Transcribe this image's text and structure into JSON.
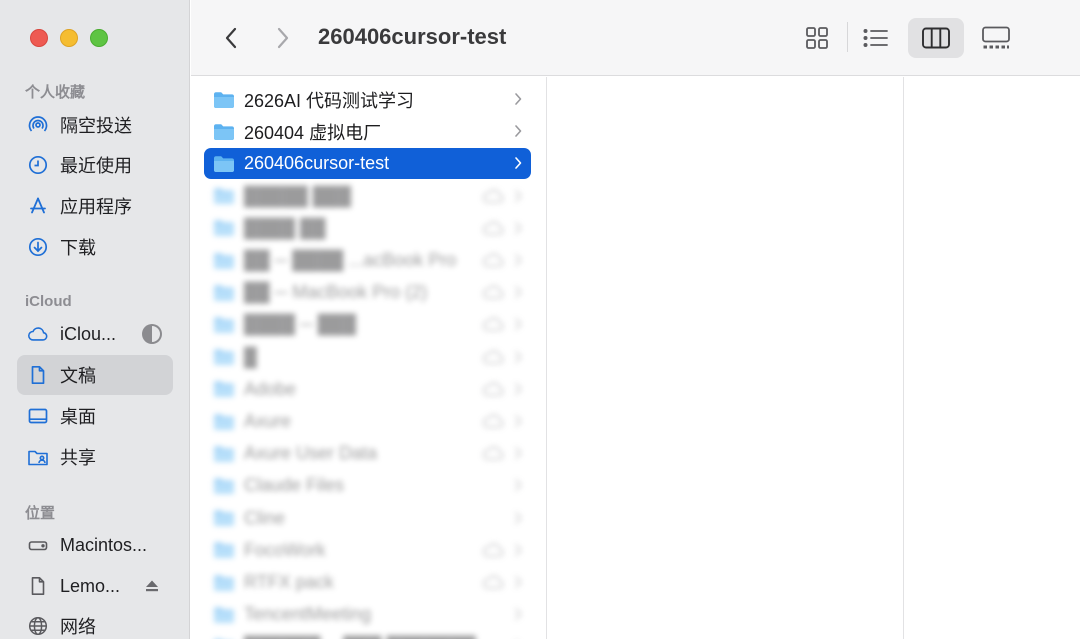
{
  "window": {
    "title": "260406cursor-test",
    "traffic_lights": {
      "close": "#ee5a52",
      "minimize": "#f5bd31",
      "zoom": "#5ec443"
    }
  },
  "sidebar": {
    "sections": [
      {
        "title": "个人收藏",
        "items": [
          {
            "label": "隔空投送",
            "icon": "airdrop-icon"
          },
          {
            "label": "最近使用",
            "icon": "clock-icon"
          },
          {
            "label": "应用程序",
            "icon": "applications-icon"
          },
          {
            "label": "下载",
            "icon": "download-icon"
          }
        ]
      },
      {
        "title": "iCloud",
        "items": [
          {
            "label": "iClou...",
            "icon": "cloud-icon",
            "extra": "storage-pie-icon"
          },
          {
            "label": "文稿",
            "icon": "document-icon",
            "selected": true
          },
          {
            "label": "桌面",
            "icon": "desktop-icon"
          },
          {
            "label": "共享",
            "icon": "shared-folder-icon"
          }
        ]
      },
      {
        "title": "位置",
        "items": [
          {
            "label": "Macintos...",
            "icon": "hard-drive-icon"
          },
          {
            "label": "Lemo...",
            "icon": "file-icon",
            "extra": "eject-icon"
          },
          {
            "label": "网络",
            "icon": "network-globe-icon"
          }
        ]
      }
    ]
  },
  "toolbar": {
    "back": "chevron-left-icon",
    "forward": "chevron-right-icon",
    "views": [
      {
        "name": "icon-view",
        "icon": "grid-icon",
        "active": false
      },
      {
        "name": "list-view",
        "icon": "list-icon",
        "active": false
      },
      {
        "name": "column-view",
        "icon": "columns-icon",
        "active": true
      },
      {
        "name": "gallery-view",
        "icon": "gallery-icon",
        "active": false
      }
    ]
  },
  "column1": {
    "items": [
      {
        "name": "2626AI 代码测试学习",
        "type": "folder",
        "blurred": false,
        "selected": false
      },
      {
        "name": "260404 虚拟电厂",
        "type": "folder",
        "blurred": false,
        "selected": false
      },
      {
        "name": "260406cursor-test",
        "type": "folder",
        "blurred": false,
        "selected": true
      },
      {
        "name": "",
        "type": "folder",
        "blurred": true,
        "cloud": true
      },
      {
        "name": "",
        "type": "folder",
        "blurred": true,
        "cloud": true
      },
      {
        "name": "",
        "type": "folder",
        "blurred": true,
        "cloud": true
      },
      {
        "name": "",
        "type": "folder",
        "blurred": true,
        "cloud": true
      },
      {
        "name": "",
        "type": "folder",
        "blurred": true,
        "cloud": true
      },
      {
        "name": "",
        "type": "folder",
        "blurred": true,
        "cloud": true
      },
      {
        "name": "",
        "type": "folder",
        "blurred": true,
        "cloud": true
      },
      {
        "name": "",
        "type": "folder",
        "blurred": true,
        "cloud": true
      },
      {
        "name": "",
        "type": "folder",
        "blurred": true,
        "cloud": true
      },
      {
        "name": "",
        "type": "folder",
        "blurred": true,
        "cloud": false
      },
      {
        "name": "",
        "type": "folder",
        "blurred": true,
        "cloud": false
      },
      {
        "name": "",
        "type": "folder",
        "blurred": true,
        "cloud": true
      },
      {
        "name": "",
        "type": "folder",
        "blurred": true,
        "cloud": true
      },
      {
        "name": "",
        "type": "folder",
        "blurred": true,
        "cloud": false
      },
      {
        "name": "",
        "type": "folder",
        "blurred": true,
        "cloud": false
      }
    ]
  },
  "colors": {
    "selection": "#1060d8",
    "folder": "#5db2f0",
    "sidebar_bg": "#e6e7e9",
    "accent_icon": "#1f6fd6"
  }
}
